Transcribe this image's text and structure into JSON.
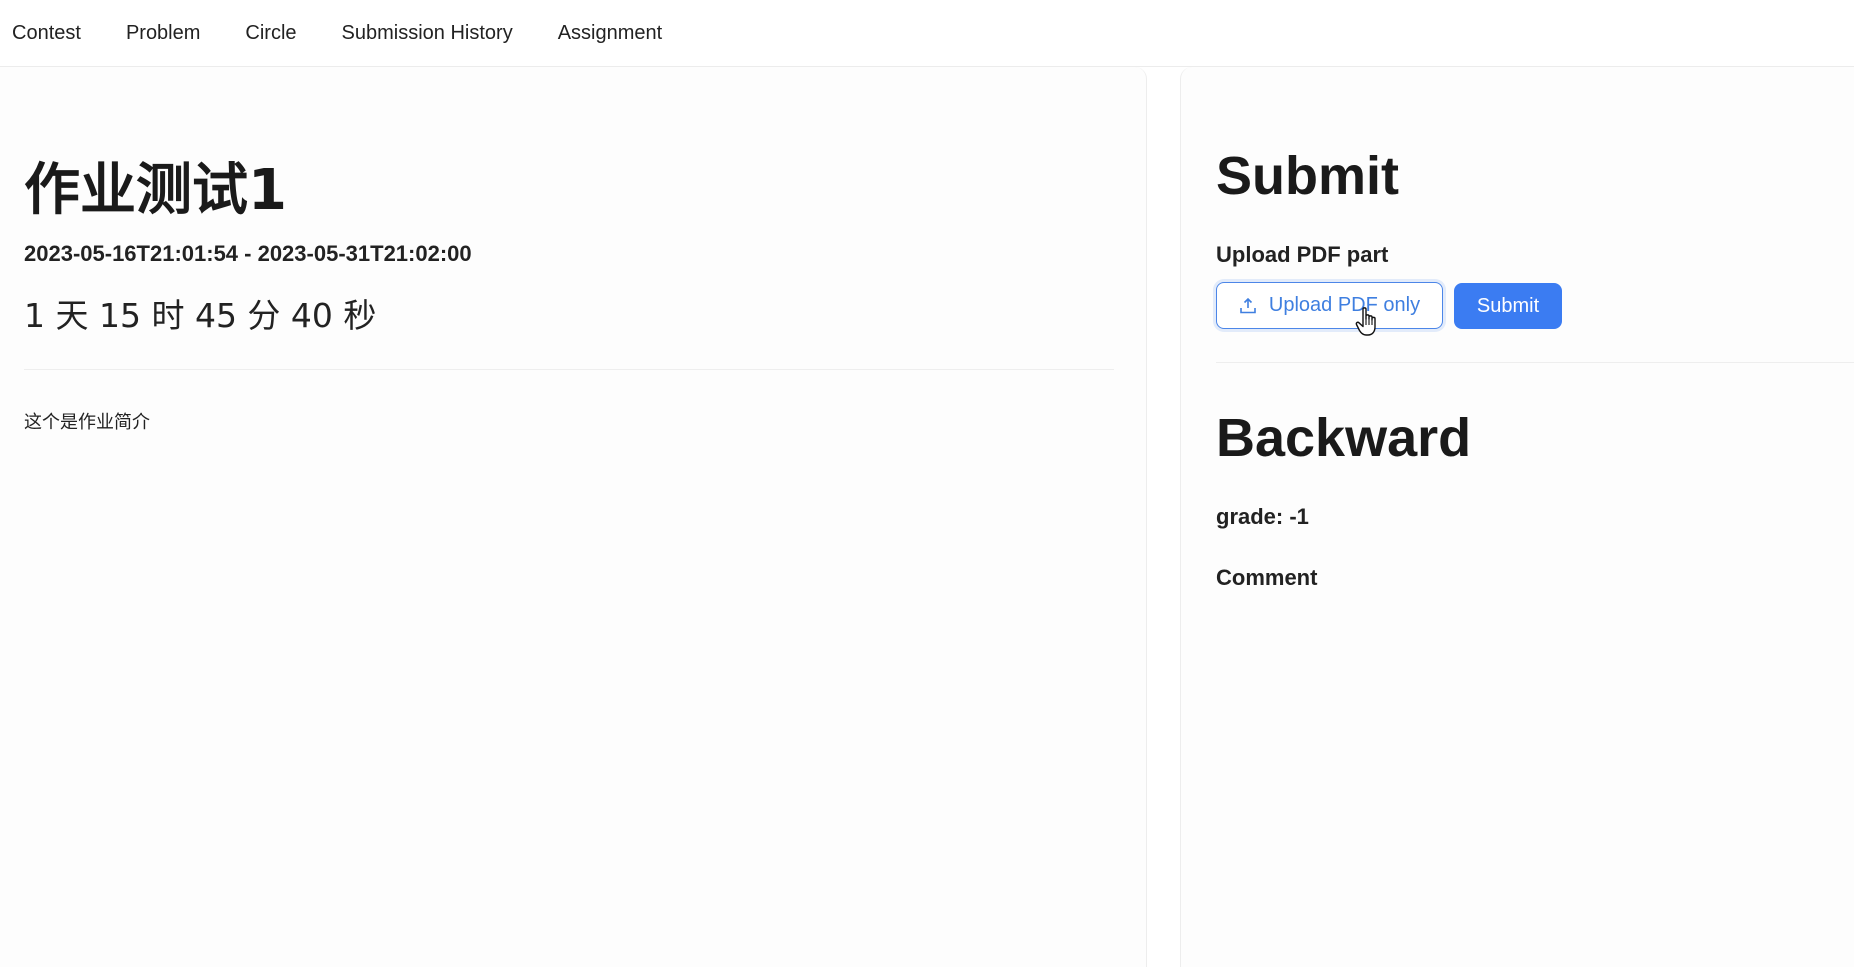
{
  "nav": {
    "items": [
      "Contest",
      "Problem",
      "Circle",
      "Submission History",
      "Assignment"
    ]
  },
  "assignment": {
    "title": "作业测试1",
    "time_range": "2023-05-16T21:01:54 - 2023-05-31T21:02:00",
    "countdown": "1 天 15 时 45 分 40 秒",
    "description": "这个是作业简介"
  },
  "submit": {
    "heading": "Submit",
    "upload_label": "Upload PDF part",
    "upload_button": "Upload PDF only",
    "submit_button": "Submit"
  },
  "backward": {
    "heading": "Backward",
    "grade": "grade: -1",
    "comment_label": "Comment"
  },
  "colors": {
    "primary": "#3b7cf2",
    "upload_text": "#3f7fe0"
  },
  "icons": {
    "upload": "upload-icon",
    "cursor": "hand-pointer-icon"
  }
}
